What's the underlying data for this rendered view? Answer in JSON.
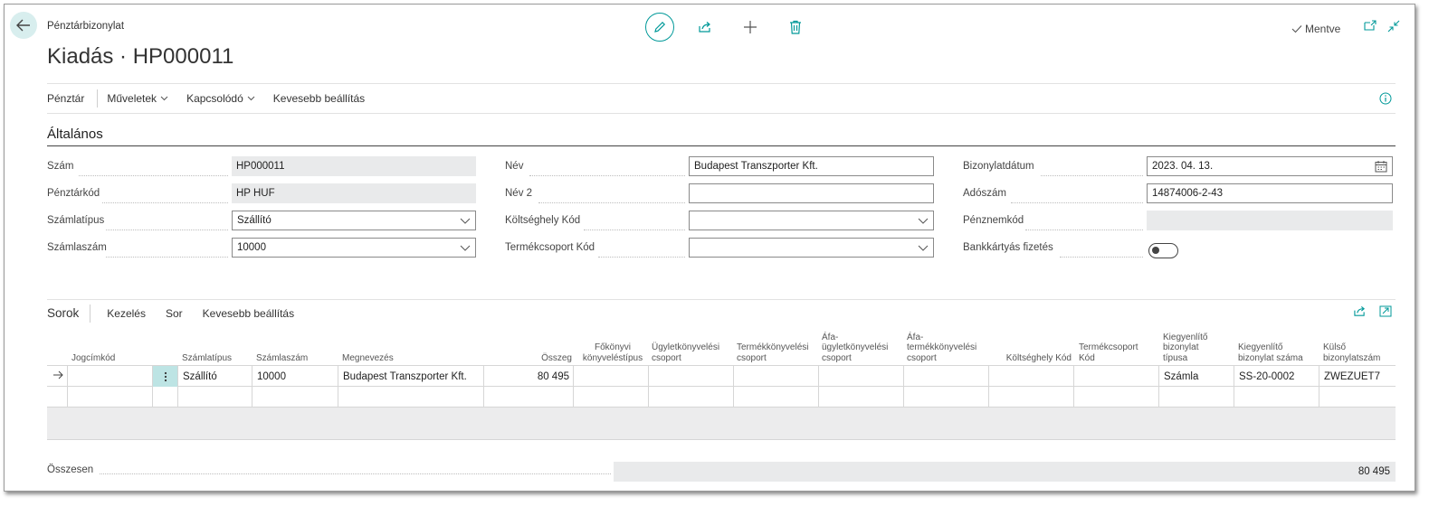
{
  "header": {
    "breadcrumb": "Pénztárbizonylat",
    "title": "Kiadás · HP000011",
    "saved_label": "Mentve"
  },
  "menu": {
    "items": [
      "Pénztár",
      "Műveletek",
      "Kapcsolódó",
      "Kevesebb beállítás"
    ]
  },
  "general": {
    "section_title": "Általános",
    "fields": {
      "szam": {
        "label": "Szám",
        "value": "HP000011"
      },
      "penztarkod": {
        "label": "Pénztárkód",
        "value": "HP HUF"
      },
      "szamlatipus": {
        "label": "Számlatípus",
        "value": "Szállító"
      },
      "szamlaszam": {
        "label": "Számlaszám",
        "value": "10000"
      },
      "nev": {
        "label": "Név",
        "value": "Budapest Transzporter Kft."
      },
      "nev2": {
        "label": "Név 2",
        "value": ""
      },
      "koltseghely": {
        "label": "Költséghely Kód",
        "value": ""
      },
      "termekcsoport": {
        "label": "Termékcsoport Kód",
        "value": ""
      },
      "bizonylatdatum": {
        "label": "Bizonylatdátum",
        "value": "2023. 04. 13."
      },
      "adoszam": {
        "label": "Adószám",
        "value": "14874006-2-43"
      },
      "penznemkod": {
        "label": "Pénznemkód",
        "value": ""
      },
      "bankkartya": {
        "label": "Bankkártyás fizetés",
        "value": false
      }
    }
  },
  "lines": {
    "title": "Sorok",
    "actions": [
      "Kezelés",
      "Sor",
      "Kevesebb beállítás"
    ],
    "columns": [
      "Jogcímkód",
      "Számlatípus",
      "Számlaszám",
      "Megnevezés",
      "Összeg",
      "Főkönyvi\nkönyveléstípus",
      "Ügyletkönyvelési\ncsoport",
      "Termékkönyvelési\ncsoport",
      "Áfa-\nügyletkönyvelési\ncsoport",
      "Áfa-\ntermékkönyvelési\ncsoport",
      "Költséghely Kód",
      "Termékcsoport\nKód",
      "Kiegyenlítő\nbizonylat\ntípusa",
      "Kiegyenlítő\nbizonylat száma",
      "Külső\nbizonylatszám"
    ],
    "rows": [
      {
        "jogcimkod": "",
        "szamlatipus": "Szállító",
        "szamlaszam": "10000",
        "megnevezes": "Budapest Transzporter Kft.",
        "osszeg": "80 495",
        "fokonyvi": "",
        "ugylet": "",
        "termek": "",
        "afa_ugylet": "",
        "afa_termek": "",
        "koltseghely": "",
        "termekcsoport": "",
        "kiegy_tipus": "Számla",
        "kiegy_szam": "SS-20-0002",
        "kulso": "ZWEZUET7"
      }
    ]
  },
  "total": {
    "label": "Összesen",
    "value": "80 495"
  },
  "colors": {
    "accent": "#009999",
    "readonly_bg": "#e9eaeb",
    "selection": "#bde4e4"
  }
}
